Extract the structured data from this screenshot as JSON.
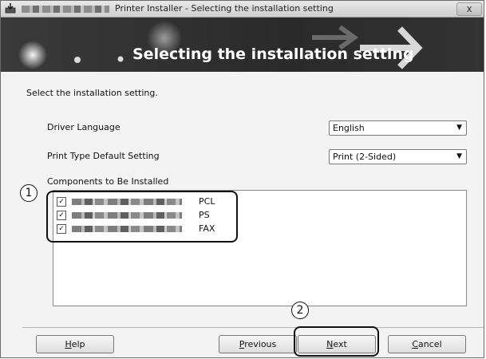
{
  "window": {
    "title": "Printer Installer - Selecting the installation setting",
    "close_label": "x"
  },
  "banner": {
    "heading": "Selecting the installation setting"
  },
  "main": {
    "instruction": "Select the installation setting.",
    "driver_language": {
      "label": "Driver Language",
      "value": "English"
    },
    "print_type": {
      "label": "Print Type Default Setting",
      "value": "Print (2-Sided)"
    },
    "components": {
      "label": "Components to Be Installed",
      "items": [
        {
          "suffix": "PCL",
          "checked": true
        },
        {
          "suffix": "PS",
          "checked": true
        },
        {
          "suffix": "FAX",
          "checked": true
        }
      ]
    }
  },
  "callouts": {
    "one": "1",
    "two": "2"
  },
  "buttons": {
    "help": {
      "underline": "H",
      "rest": "elp"
    },
    "previous": {
      "underline": "P",
      "rest": "revious"
    },
    "next": {
      "underline": "N",
      "rest": "ext"
    },
    "cancel": {
      "underline": "C",
      "rest": "ancel"
    }
  },
  "icons": {
    "checkbox": "check-icon",
    "dropdown": "chevron-down-icon",
    "app": "installer-icon",
    "close": "close-icon"
  }
}
